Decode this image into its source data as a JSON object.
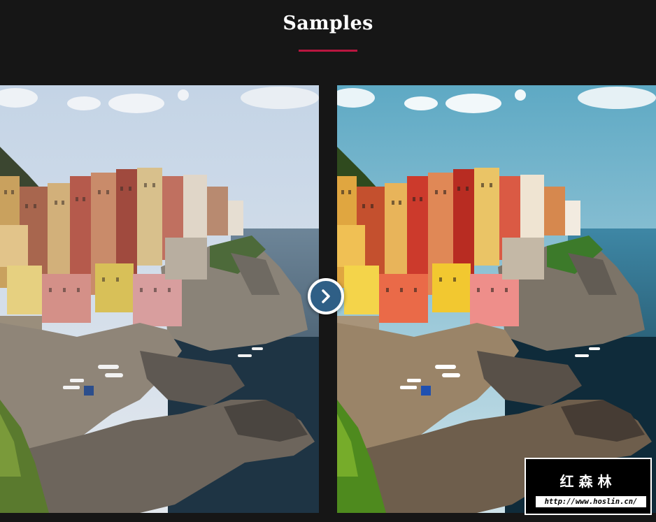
{
  "header": {
    "title": "Samples",
    "accent_color": "#b8163f"
  },
  "comparison": {
    "before_image_label": "",
    "after_image_label": "",
    "handle_icon": "chevron-right-icon",
    "handle_color": "#2f5f86"
  },
  "watermark": {
    "title": "红森林",
    "url": "http://www.hoslin.cn/"
  }
}
